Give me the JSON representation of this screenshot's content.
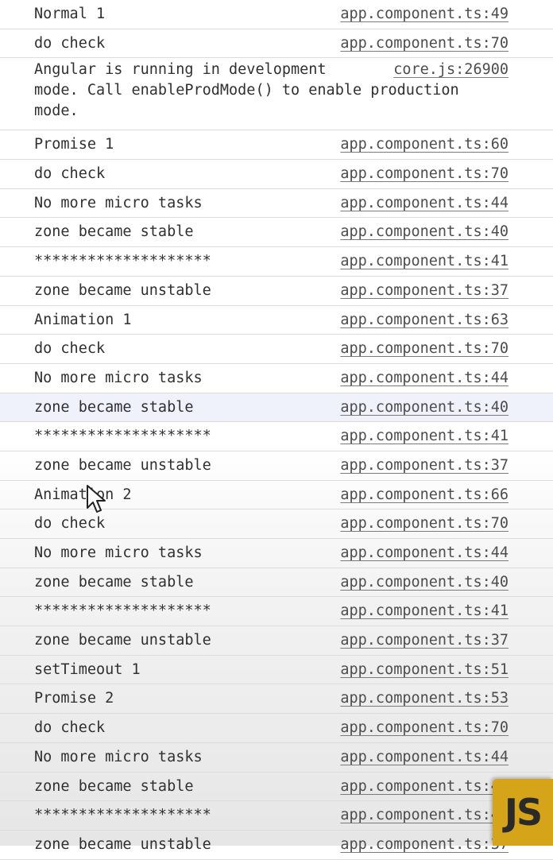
{
  "console": {
    "rows": [
      {
        "message": "Normal 1",
        "source": "app.component.ts:49"
      },
      {
        "message": "do check",
        "source": "app.component.ts:70"
      },
      {
        "message": "Angular is running in development\nmode. Call enableProdMode() to enable production\nmode.",
        "source": "core.js:26900",
        "multiline": true
      },
      {
        "message": "Promise 1",
        "source": "app.component.ts:60"
      },
      {
        "message": "do check",
        "source": "app.component.ts:70"
      },
      {
        "message": "No more micro tasks",
        "source": "app.component.ts:44"
      },
      {
        "message": "zone became stable",
        "source": "app.component.ts:40"
      },
      {
        "message": "********************",
        "source": "app.component.ts:41"
      },
      {
        "message": "zone became unstable",
        "source": "app.component.ts:37"
      },
      {
        "message": "Animation 1",
        "source": "app.component.ts:63"
      },
      {
        "message": "do check",
        "source": "app.component.ts:70"
      },
      {
        "message": "No more micro tasks",
        "source": "app.component.ts:44"
      },
      {
        "message": "zone became stable",
        "source": "app.component.ts:40",
        "highlighted": true
      },
      {
        "message": "********************",
        "source": "app.component.ts:41"
      },
      {
        "message": "zone became unstable",
        "source": "app.component.ts:37"
      },
      {
        "message": "Animation 2",
        "source": "app.component.ts:66"
      },
      {
        "message": "do check",
        "source": "app.component.ts:70"
      },
      {
        "message": "No more micro tasks",
        "source": "app.component.ts:44"
      },
      {
        "message": "zone became stable",
        "source": "app.component.ts:40"
      },
      {
        "message": "********************",
        "source": "app.component.ts:41"
      },
      {
        "message": "zone became unstable",
        "source": "app.component.ts:37"
      },
      {
        "message": "setTimeout 1",
        "source": "app.component.ts:51"
      },
      {
        "message": "Promise 2",
        "source": "app.component.ts:53"
      },
      {
        "message": "do check",
        "source": "app.component.ts:70"
      },
      {
        "message": "No more micro tasks",
        "source": "app.component.ts:44"
      },
      {
        "message": "zone became stable",
        "source": "app.component.ts:40"
      },
      {
        "message": "********************",
        "source": "app.component.ts:41"
      },
      {
        "message": "zone became unstable",
        "source": "app.component.ts:37"
      }
    ]
  },
  "overlay": {
    "cursor_icon": "mouse-pointer-icon",
    "logo_text": "JS",
    "logo_color": "#d6a419"
  }
}
